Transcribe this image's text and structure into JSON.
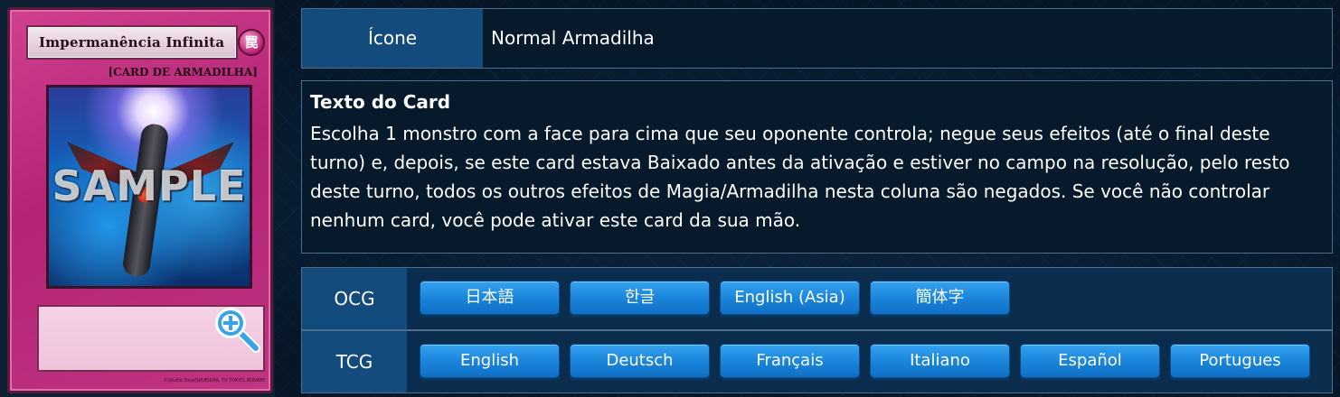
{
  "card": {
    "name": "Impermanência Infinita",
    "attribute_symbol": "罠",
    "type_line": "[CARD DE ARMADILHA]",
    "watermark": "SAMPLE",
    "copyright": "©Studio Dice/SHUEISHA, TV TOKYO, KONAMI",
    "frame_color": "#c0347f",
    "zoom_icon": "zoom-in-icon"
  },
  "icon_row": {
    "label": "Ícone",
    "value": "Normal Armadilha"
  },
  "card_text": {
    "title": "Texto do Card",
    "body": "Escolha 1 monstro com a face para cima que seu oponente controla; negue seus efeitos (até o final deste turno) e, depois, se este card estava Baixado antes da ativação e estiver no campo na resolução, pelo resto deste turno, todos os outros efeitos de Magia/Armadilha nesta coluna são negados. Se você não controlar nenhum card, você pode ativar este card da sua mão."
  },
  "ocg": {
    "label": "OCG",
    "languages": [
      "日本語",
      "한글",
      "English (Asia)",
      "簡体字"
    ]
  },
  "tcg": {
    "label": "TCG",
    "languages": [
      "English",
      "Deutsch",
      "Français",
      "Italiano",
      "Español",
      "Portugues"
    ]
  },
  "colors": {
    "background": "#071a2b",
    "label_bg": "#134b7d",
    "button_blue": "#1a86dc"
  }
}
